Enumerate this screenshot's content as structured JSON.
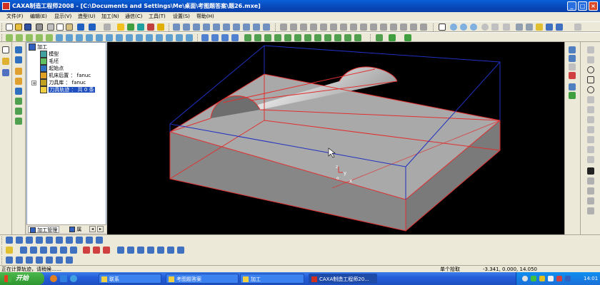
{
  "window": {
    "title": "CAXA制造工程师2008  - [C:\\Documents and Settings\\Me\\桌面\\考图题答案\\题26.mxe]",
    "buttons": {
      "minimize": "_",
      "maximize": "□",
      "close": "×"
    }
  },
  "menu": [
    "文件(F)",
    "编辑(E)",
    "显示(V)",
    "造型(U)",
    "加工(N)",
    "通信(C)",
    "工具(T)",
    "设置(S)",
    "帮助(H)"
  ],
  "tree": {
    "root": "加工",
    "items": [
      {
        "label": "模型",
        "icon": "model-icon"
      },
      {
        "label": "毛坯",
        "icon": "blank-icon"
      },
      {
        "label": "起始点",
        "icon": "start-point-icon"
      },
      {
        "label": "机床后置 ： fanuc",
        "icon": "machine-post-icon"
      },
      {
        "label": "刀具库 ： fanuc",
        "icon": "tool-library-icon"
      },
      {
        "label": "刀具轨迹 ： 共 0 条",
        "icon": "toolpath-folder-icon"
      }
    ],
    "tabs": [
      "加工管理",
      "属"
    ]
  },
  "viewport": {
    "axis_labels": {
      "z": "z",
      "y": "y",
      "x": "x",
      "origin": "o"
    }
  },
  "status": {
    "message": "正在计算轨迹，请稍候……",
    "pick_mode": "单个拾取",
    "coordinates": "-3.341, 0.000, 14.050"
  },
  "taskbar": {
    "start": "开始",
    "tasks": [
      "联系",
      "考图题答案",
      "加工",
      "CAXA制造工程师20..."
    ],
    "clock": "14:01"
  },
  "colors": {
    "title_bar": "#0a5fd8",
    "viewport_bg": "#000000",
    "model_edge": "#e03030",
    "bbox_edge": "#2030c0",
    "model_fill": "#8a8a8a"
  }
}
